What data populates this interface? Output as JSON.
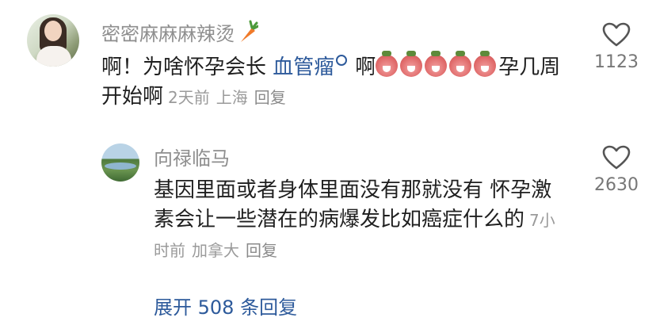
{
  "comments": [
    {
      "username": "密密麻麻麻辣烫",
      "text_before": "啊！为啥怀孕会长 ",
      "link_text": "血管瘤",
      "text_mid": "啊",
      "emoji_count": 5,
      "text_after": "孕几周开始啊",
      "time": "2天前",
      "location": "上海",
      "reply_label": "回复",
      "likes": "1123"
    }
  ],
  "reply": {
    "username": "向禄临马",
    "text": "基因里面或者身体里面没有那就没有 怀孕激素会让一些潜在的病爆发比如癌症什么的",
    "time": "7小时前",
    "location": "加拿大",
    "reply_label": "回复",
    "likes": "2630"
  },
  "expand_label": "展开 508 条回复",
  "colors": {
    "link": "#2d5a9b",
    "meta": "#9a9a9a",
    "username": "#8e8e8e"
  },
  "icons": [
    "heart-icon",
    "carrot-icon",
    "search-icon",
    "crying-emoji-icon"
  ]
}
